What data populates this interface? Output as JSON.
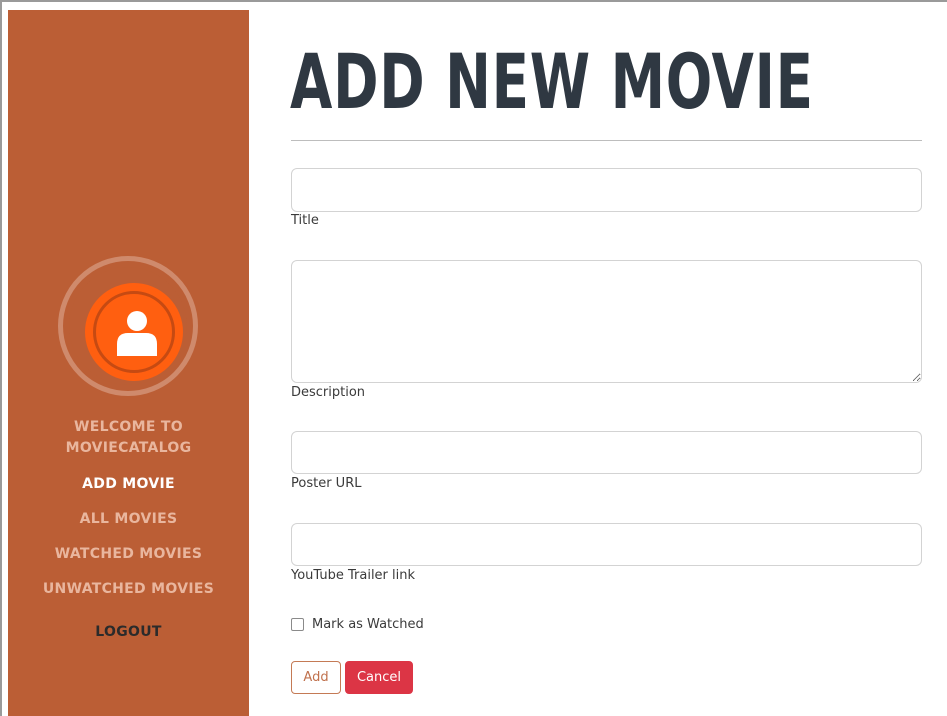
{
  "page": {
    "title": "ADD NEW MOVIE"
  },
  "sidebar": {
    "welcome_line1": "WELCOME TO",
    "welcome_line2": "MOVIECATALOG",
    "items": [
      {
        "label": "ADD MOVIE",
        "active": true
      },
      {
        "label": "ALL MOVIES",
        "active": false
      },
      {
        "label": "WATCHED MOVIES",
        "active": false
      },
      {
        "label": "UNWATCHED MOVIES",
        "active": false
      }
    ],
    "logout_label": "LOGOUT",
    "avatar_icon": "user-icon"
  },
  "form": {
    "title_label": "Title",
    "title_value": "",
    "description_label": "Description",
    "description_value": "",
    "poster_label": "Poster URL",
    "poster_value": "",
    "trailer_label": "YouTube Trailer link",
    "trailer_value": "",
    "watched_label": "Mark as Watched",
    "watched_checked": false,
    "add_label": "Add",
    "cancel_label": "Cancel"
  },
  "colors": {
    "sidebar_bg": "#bb5e35",
    "avatar_orange": "#ff5f10",
    "title_color": "#2f3842",
    "cancel_red": "#dc3545",
    "add_outline": "#c47a55"
  }
}
